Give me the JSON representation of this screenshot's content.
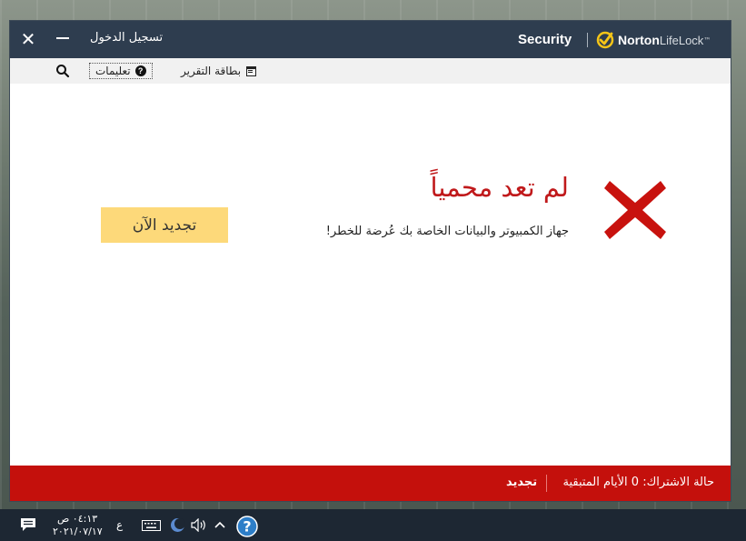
{
  "titlebar": {
    "close_glyph": "✕",
    "signin_label": "تسجيل الدخول",
    "product_label": "Security",
    "brand_norton": "Norton",
    "brand_lifelock": "LifeLock",
    "brand_tm": "™"
  },
  "toolbar": {
    "help_label": "تعليمات",
    "report_card_label": "بطاقة التقرير"
  },
  "main": {
    "status_title": "لم تعد محمياً",
    "status_description": "جهاز الكمبيوتر والبيانات الخاصة بك عُرضة للخطر!",
    "renew_button_label": "تجديد الآن"
  },
  "footer": {
    "subscription_status": "حالة الاشتراك: 0 الأيام المتبقية",
    "renew_link": "تجديد"
  },
  "taskbar": {
    "time": "٠٤:١٣ ص",
    "date": "٢٠٢١/٠٧/١٧",
    "language": "ع"
  },
  "colors": {
    "titlebar": "#2e3d4f",
    "alert_red": "#c4100c",
    "accent_yellow": "#fdd97a",
    "norton_yellow": "#f5c518"
  },
  "icons": [
    "close-icon",
    "minimize-icon",
    "search-icon",
    "help-icon",
    "report-card-icon",
    "red-x-icon",
    "action-center-icon",
    "keyboard-icon",
    "network-icon",
    "volume-icon",
    "chevron-up-icon",
    "norton-tray-icon"
  ]
}
